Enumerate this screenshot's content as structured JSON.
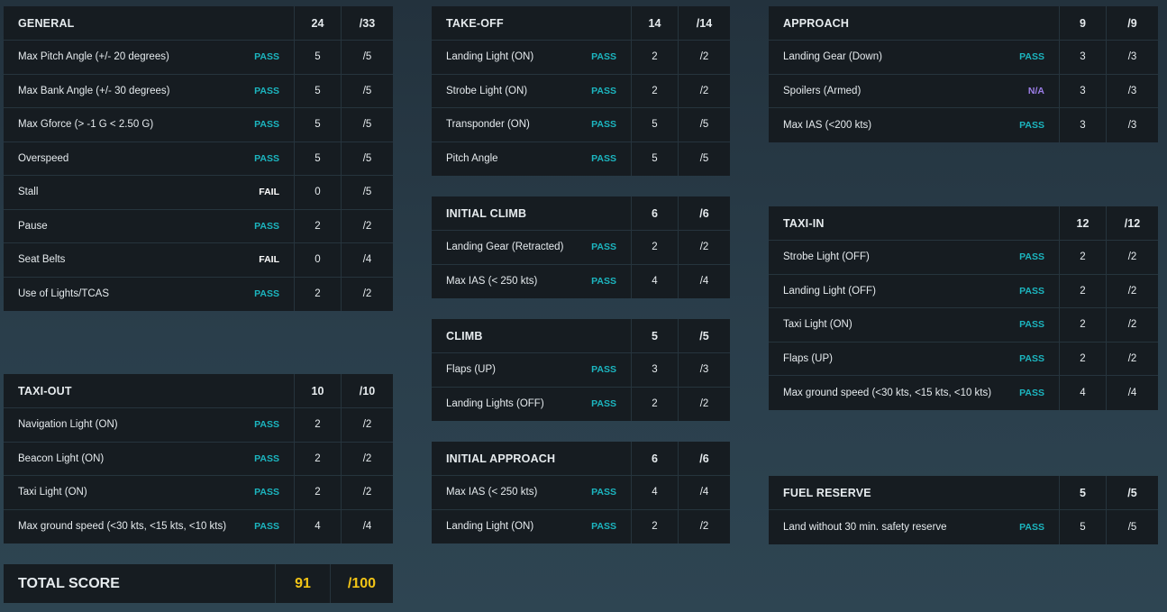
{
  "colors": {
    "pass": "#1cb6c0",
    "fail": "#ffffff",
    "na": "#9c7ee8",
    "total": "#f2c416"
  },
  "sections": [
    {
      "id": "general",
      "title": "GENERAL",
      "score": "24",
      "max": "/33",
      "rows": [
        {
          "label": "Max Pitch Angle (+/- 20 degrees)",
          "status": "PASS",
          "score": "5",
          "max": "/5"
        },
        {
          "label": "Max Bank Angle (+/- 30 degrees)",
          "status": "PASS",
          "score": "5",
          "max": "/5"
        },
        {
          "label": "Max Gforce (> -1 G < 2.50 G)",
          "status": "PASS",
          "score": "5",
          "max": "/5"
        },
        {
          "label": "Overspeed",
          "status": "PASS",
          "score": "5",
          "max": "/5"
        },
        {
          "label": "Stall",
          "status": "FAIL",
          "score": "0",
          "max": "/5"
        },
        {
          "label": "Pause",
          "status": "PASS",
          "score": "2",
          "max": "/2"
        },
        {
          "label": "Seat Belts",
          "status": "FAIL",
          "score": "0",
          "max": "/4"
        },
        {
          "label": "Use of Lights/TCAS",
          "status": "PASS",
          "score": "2",
          "max": "/2"
        }
      ]
    },
    {
      "id": "taxi-out",
      "title": "TAXI-OUT",
      "score": "10",
      "max": "/10",
      "rows": [
        {
          "label": "Navigation Light (ON)",
          "status": "PASS",
          "score": "2",
          "max": "/2"
        },
        {
          "label": "Beacon Light (ON)",
          "status": "PASS",
          "score": "2",
          "max": "/2"
        },
        {
          "label": "Taxi Light (ON)",
          "status": "PASS",
          "score": "2",
          "max": "/2"
        },
        {
          "label": "Max ground speed (<30 kts, <15 kts, <10 kts)",
          "status": "PASS",
          "score": "4",
          "max": "/4"
        }
      ]
    },
    {
      "id": "take-off",
      "title": "TAKE-OFF",
      "score": "14",
      "max": "/14",
      "rows": [
        {
          "label": "Landing Light (ON)",
          "status": "PASS",
          "score": "2",
          "max": "/2"
        },
        {
          "label": "Strobe Light (ON)",
          "status": "PASS",
          "score": "2",
          "max": "/2"
        },
        {
          "label": "Transponder (ON)",
          "status": "PASS",
          "score": "5",
          "max": "/5"
        },
        {
          "label": "Pitch Angle",
          "status": "PASS",
          "score": "5",
          "max": "/5"
        }
      ]
    },
    {
      "id": "initial-climb",
      "title": "INITIAL CLIMB",
      "score": "6",
      "max": "/6",
      "rows": [
        {
          "label": "Landing Gear (Retracted)",
          "status": "PASS",
          "score": "2",
          "max": "/2"
        },
        {
          "label": "Max IAS (< 250 kts)",
          "status": "PASS",
          "score": "4",
          "max": "/4"
        }
      ]
    },
    {
      "id": "climb",
      "title": "CLIMB",
      "score": "5",
      "max": "/5",
      "rows": [
        {
          "label": "Flaps (UP)",
          "status": "PASS",
          "score": "3",
          "max": "/3"
        },
        {
          "label": "Landing Lights (OFF)",
          "status": "PASS",
          "score": "2",
          "max": "/2"
        }
      ]
    },
    {
      "id": "initial-approach",
      "title": "INITIAL APPROACH",
      "score": "6",
      "max": "/6",
      "rows": [
        {
          "label": "Max IAS (< 250 kts)",
          "status": "PASS",
          "score": "4",
          "max": "/4"
        },
        {
          "label": "Landing Light (ON)",
          "status": "PASS",
          "score": "2",
          "max": "/2"
        }
      ]
    },
    {
      "id": "approach",
      "title": "APPROACH",
      "score": "9",
      "max": "/9",
      "rows": [
        {
          "label": "Landing Gear (Down)",
          "status": "PASS",
          "score": "3",
          "max": "/3"
        },
        {
          "label": "Spoilers (Armed)",
          "status": "N/A",
          "score": "3",
          "max": "/3"
        },
        {
          "label": "Max IAS (<200 kts)",
          "status": "PASS",
          "score": "3",
          "max": "/3"
        }
      ]
    },
    {
      "id": "taxi-in",
      "title": "TAXI-IN",
      "score": "12",
      "max": "/12",
      "rows": [
        {
          "label": "Strobe Light (OFF)",
          "status": "PASS",
          "score": "2",
          "max": "/2"
        },
        {
          "label": "Landing Light (OFF)",
          "status": "PASS",
          "score": "2",
          "max": "/2"
        },
        {
          "label": "Taxi Light (ON)",
          "status": "PASS",
          "score": "2",
          "max": "/2"
        },
        {
          "label": "Flaps (UP)",
          "status": "PASS",
          "score": "2",
          "max": "/2"
        },
        {
          "label": "Max ground speed (<30 kts, <15 kts, <10 kts)",
          "status": "PASS",
          "score": "4",
          "max": "/4"
        }
      ]
    },
    {
      "id": "fuel-reserve",
      "title": "FUEL RESERVE",
      "score": "5",
      "max": "/5",
      "rows": [
        {
          "label": "Land without 30 min. safety reserve",
          "status": "PASS",
          "score": "5",
          "max": "/5"
        }
      ]
    }
  ],
  "total": {
    "label": "TOTAL SCORE",
    "score": "91",
    "max": "/100"
  }
}
